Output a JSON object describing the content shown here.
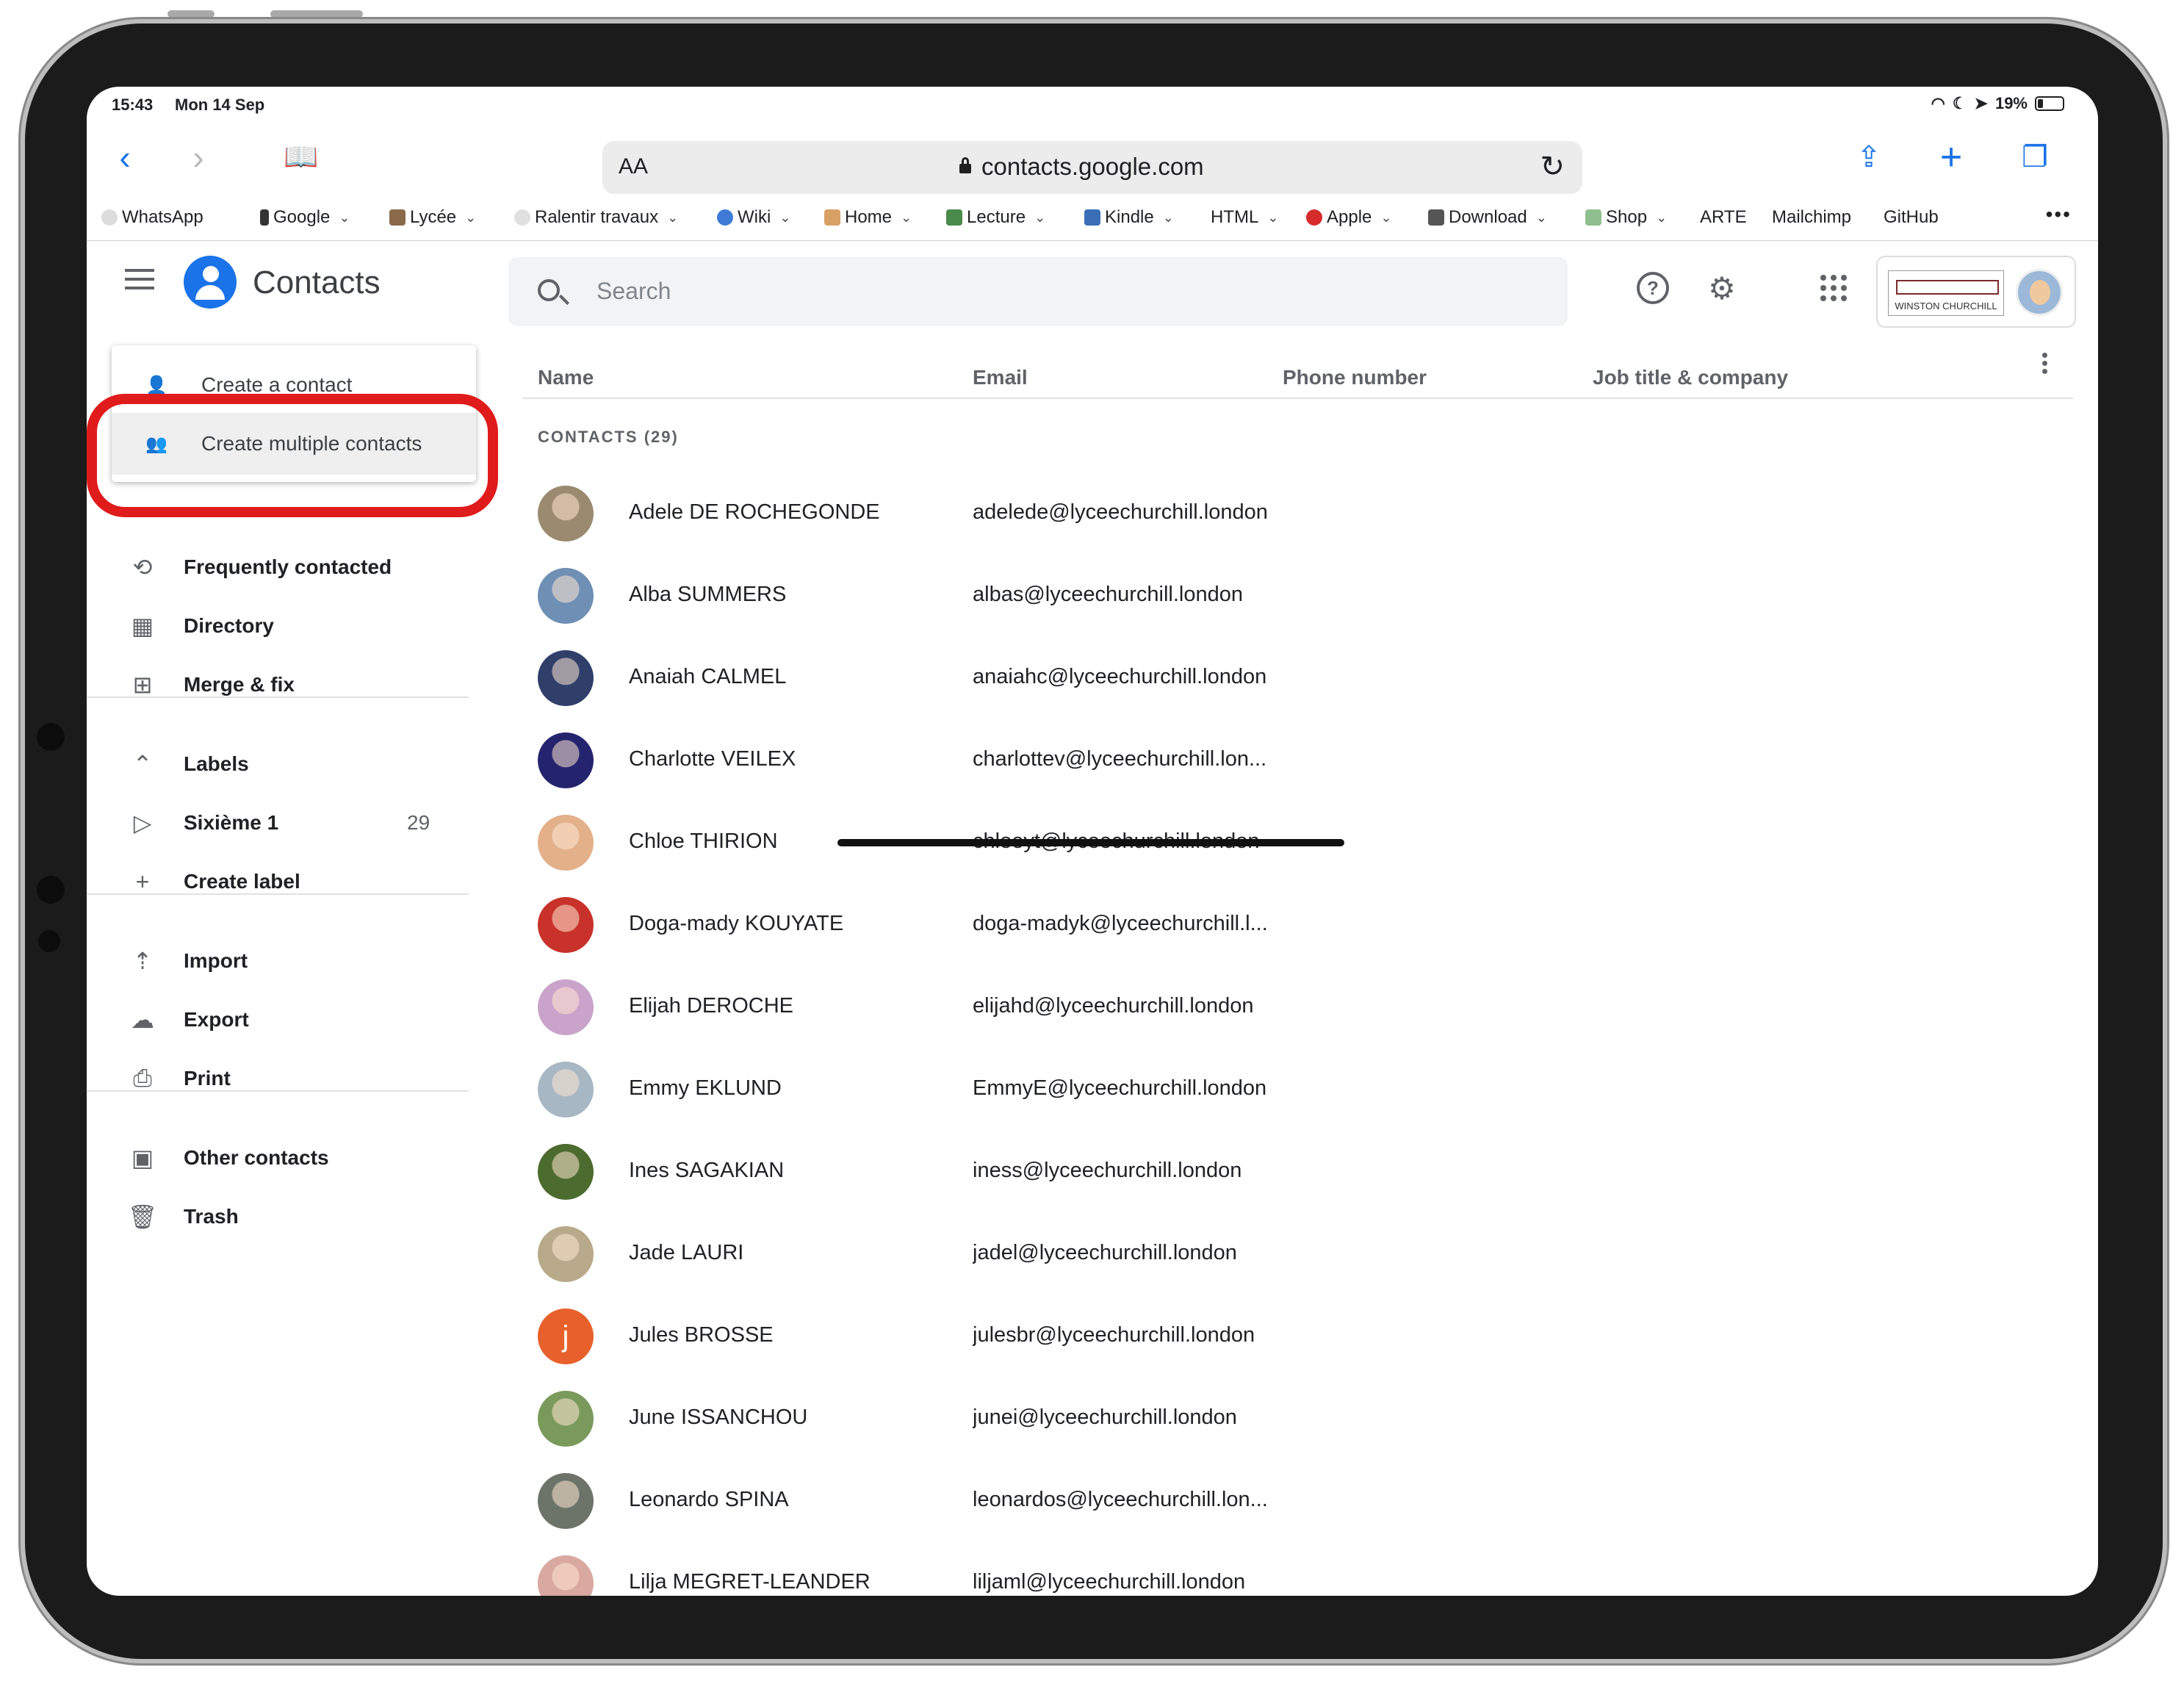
{
  "status_bar": {
    "time": "15:43",
    "date": "Mon 14 Sep",
    "battery": "19%"
  },
  "browser": {
    "text_size_label": "AA",
    "url": "contacts.google.com",
    "bookmarks": [
      {
        "label": "WhatsApp",
        "dropdown": false
      },
      {
        "label": "Google",
        "dropdown": true
      },
      {
        "label": "Lycée",
        "dropdown": true
      },
      {
        "label": "Ralentir travaux",
        "dropdown": true
      },
      {
        "label": "Wiki",
        "dropdown": true
      },
      {
        "label": "Home",
        "dropdown": true
      },
      {
        "label": "Lecture",
        "dropdown": true
      },
      {
        "label": "Kindle",
        "dropdown": true
      },
      {
        "label": "HTML",
        "dropdown": true
      },
      {
        "label": "Apple",
        "dropdown": true
      },
      {
        "label": "Download",
        "dropdown": true
      },
      {
        "label": "Shop",
        "dropdown": true
      },
      {
        "label": "ARTE",
        "dropdown": false
      },
      {
        "label": "Mailchimp",
        "dropdown": false
      },
      {
        "label": "GitHub",
        "dropdown": false
      }
    ]
  },
  "app": {
    "title": "Contacts",
    "search_placeholder": "Search",
    "org_logo_text": "WINSTON CHURCHILL"
  },
  "create_menu": {
    "items": [
      "Create a contact",
      "Create multiple contacts"
    ],
    "highlighted": "Create multiple contacts"
  },
  "sidebar": {
    "primary": [
      "Frequently contacted",
      "Directory",
      "Merge & fix"
    ],
    "labels_header": "Labels",
    "labels": [
      {
        "name": "Sixième 1",
        "count": "29"
      }
    ],
    "create_label": "Create label",
    "tools": [
      "Import",
      "Export",
      "Print"
    ],
    "other": [
      "Other contacts",
      "Trash"
    ]
  },
  "table": {
    "columns": [
      "Name",
      "Email",
      "Phone number",
      "Job title & company"
    ],
    "section_label": "CONTACTS (29)",
    "rows": [
      {
        "name": "Adele DE ROCHEGONDE",
        "email": "adelede@lyceechurchill.london",
        "avatar_color": "#9b8a70"
      },
      {
        "name": "Alba SUMMERS",
        "email": "albas@lyceechurchill.london",
        "avatar_color": "#6f8fb5"
      },
      {
        "name": "Anaiah CALMEL",
        "email": "anaiahc@lyceechurchill.london",
        "avatar_color": "#2f3f6a"
      },
      {
        "name": "Charlotte VEILEX",
        "email": "charlottev@lyceechurchill.lon...",
        "avatar_color": "#24246e"
      },
      {
        "name": "Chloe THIRION",
        "email": "chloeyt@lyceechurchill.london",
        "avatar_color": "#e3b08a"
      },
      {
        "name": "Doga-mady KOUYATE",
        "email": "doga-madyk@lyceechurchill.l...",
        "avatar_color": "#c8322a"
      },
      {
        "name": "Elijah DEROCHE",
        "email": "elijahd@lyceechurchill.london",
        "avatar_color": "#c9a3c9"
      },
      {
        "name": "Emmy EKLUND",
        "email": "EmmyE@lyceechurchill.london",
        "avatar_color": "#a7b7c4"
      },
      {
        "name": "Ines SAGAKIAN",
        "email": "iness@lyceechurchill.london",
        "avatar_color": "#4c6b2e"
      },
      {
        "name": "Jade LAURI",
        "email": "jadel@lyceechurchill.london",
        "avatar_color": "#b8a98a"
      },
      {
        "name": "Jules BROSSE",
        "email": "julesbr@lyceechurchill.london",
        "avatar_color": "#e8612c",
        "initial": "j"
      },
      {
        "name": "June ISSANCHOU",
        "email": "junei@lyceechurchill.london",
        "avatar_color": "#7a9a5c"
      },
      {
        "name": "Leonardo SPINA",
        "email": "leonardos@lyceechurchill.lon...",
        "avatar_color": "#6c7469"
      },
      {
        "name": "Lilja MEGRET-LEANDER",
        "email": "liljaml@lyceechurchill.london",
        "avatar_color": "#d9a8a0"
      }
    ]
  },
  "colors": {
    "accent": "#1a73e8",
    "highlight_ring": "#e01b1b"
  }
}
